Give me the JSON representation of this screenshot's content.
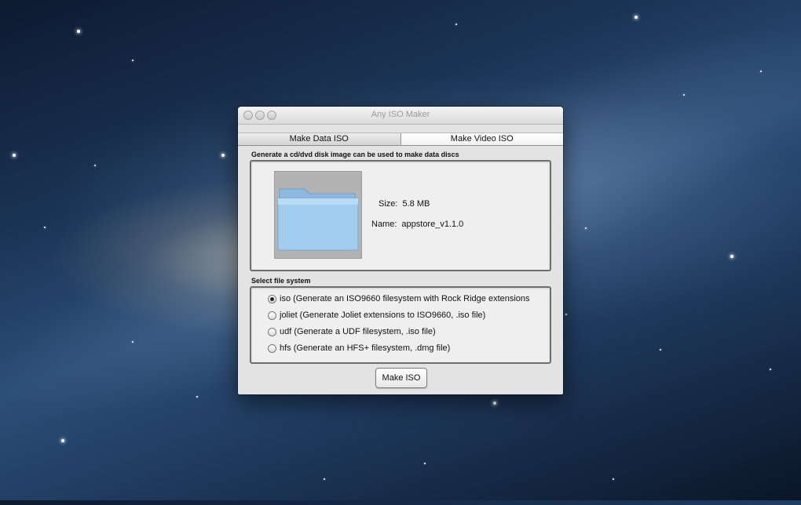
{
  "window": {
    "title": "Any ISO Maker"
  },
  "tabs": [
    {
      "label": "Make Data ISO",
      "active": false
    },
    {
      "label": "Make Video ISO",
      "active": true
    }
  ],
  "data_section": {
    "heading": "Generate a cd/dvd disk image can be used to make data discs",
    "size_label": "Size:",
    "size_value": "5.8 MB",
    "name_label": "Name:",
    "name_value": "appstore_v1.1.0"
  },
  "fs_section": {
    "heading": "Select file system",
    "options": [
      {
        "label": "iso (Generate an ISO9660 filesystem with Rock Ridge extensions",
        "selected": true
      },
      {
        "label": "joliet (Generate Joliet extensions to ISO9660, .iso file)",
        "selected": false
      },
      {
        "label": "udf (Generate a UDF filesystem, .iso file)",
        "selected": false
      },
      {
        "label": "hfs (Generate an HFS+ filesystem, .dmg file)",
        "selected": false
      }
    ]
  },
  "actions": {
    "make_iso_label": "Make ISO"
  },
  "colors": {
    "folder": "#9cc6ea",
    "desktop": "#1b3456"
  }
}
